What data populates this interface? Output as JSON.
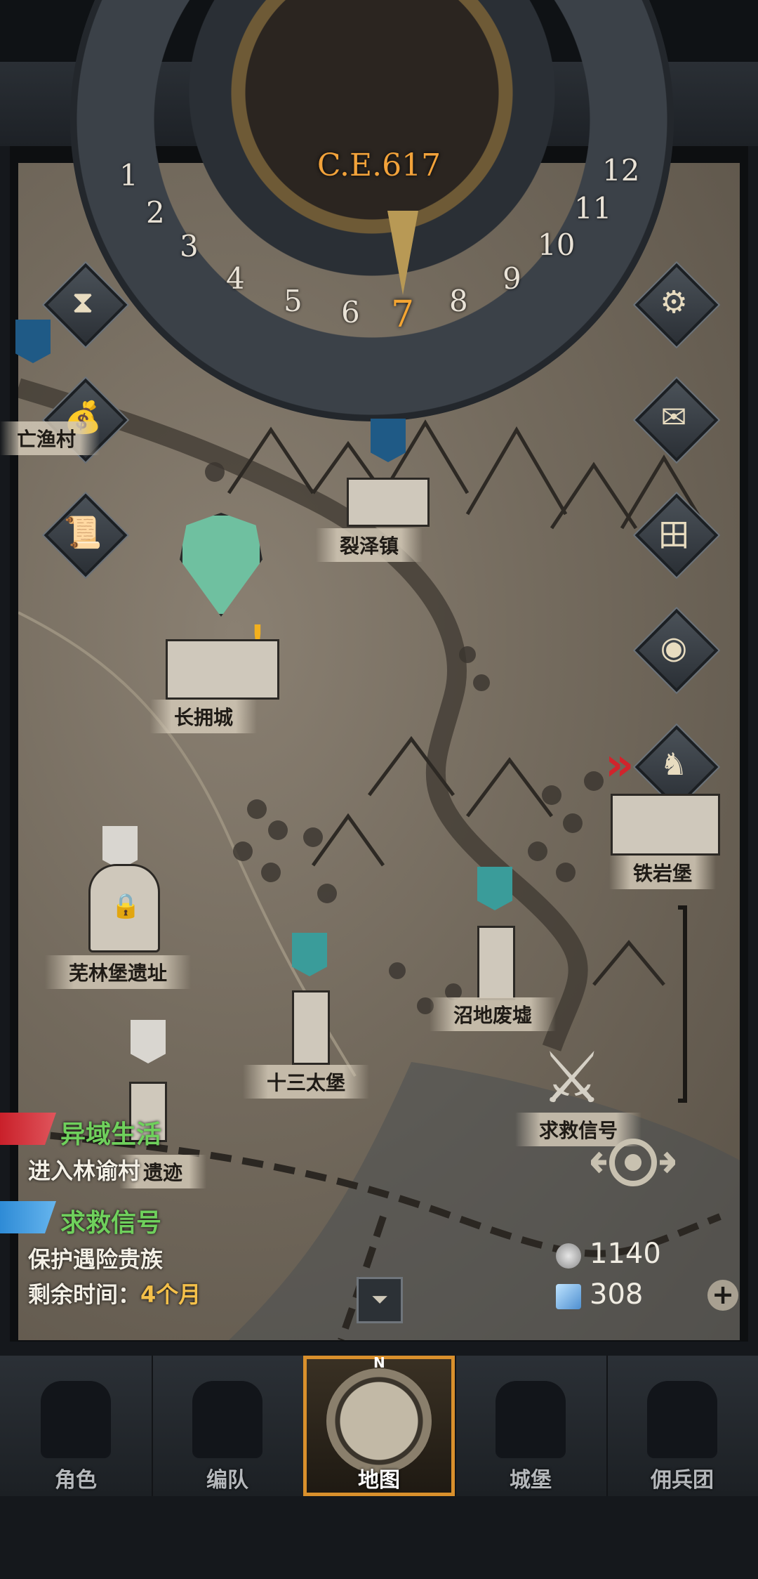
{
  "calendar": {
    "year": "C.E.617",
    "months": [
      "1",
      "2",
      "3",
      "4",
      "5",
      "6",
      "8",
      "9",
      "10",
      "11",
      "12"
    ],
    "current_month": "7"
  },
  "side_buttons": {
    "left": [
      {
        "name": "hourglass-icon",
        "glyph": "⧗"
      },
      {
        "name": "money-bag-icon",
        "glyph": "💰"
      },
      {
        "name": "scroll-icon",
        "glyph": "📜"
      }
    ],
    "right": [
      {
        "name": "gear-icon",
        "glyph": "⚙"
      },
      {
        "name": "mail-icon",
        "glyph": "✉"
      },
      {
        "name": "grid-icon",
        "glyph": "田"
      },
      {
        "name": "coin-icon",
        "glyph": "◉"
      },
      {
        "name": "knight-icon",
        "glyph": "♞"
      }
    ]
  },
  "locations": {
    "village_partial": "亡渔村",
    "lieze": "裂泽镇",
    "changyong": "长拥城",
    "tieyan": "铁岩堡",
    "wulin": "芜林堡遗址",
    "shisan": "十三太堡",
    "zhaodi": "沼地废墟",
    "qiujiu": "求救信号",
    "ruins_partial": "遗迹"
  },
  "quests": [
    {
      "title": "异域生活",
      "desc": "进入林谕村",
      "color": "#6fd05c"
    },
    {
      "title": "求救信号",
      "desc": "保护遇险贵族",
      "time_label": "剩余时间：",
      "time_value": "4个月",
      "color": "#6fd05c"
    }
  ],
  "resources": {
    "silver": "1140",
    "crystal": "308"
  },
  "nav": {
    "items": [
      "角色",
      "编队",
      "地图",
      "城堡",
      "佣兵团"
    ],
    "active": "地图",
    "compass_n": "N"
  },
  "colors": {
    "accent": "#f2a23a",
    "quest_green": "#6fd05c",
    "nav_active_border": "#d9902c"
  }
}
